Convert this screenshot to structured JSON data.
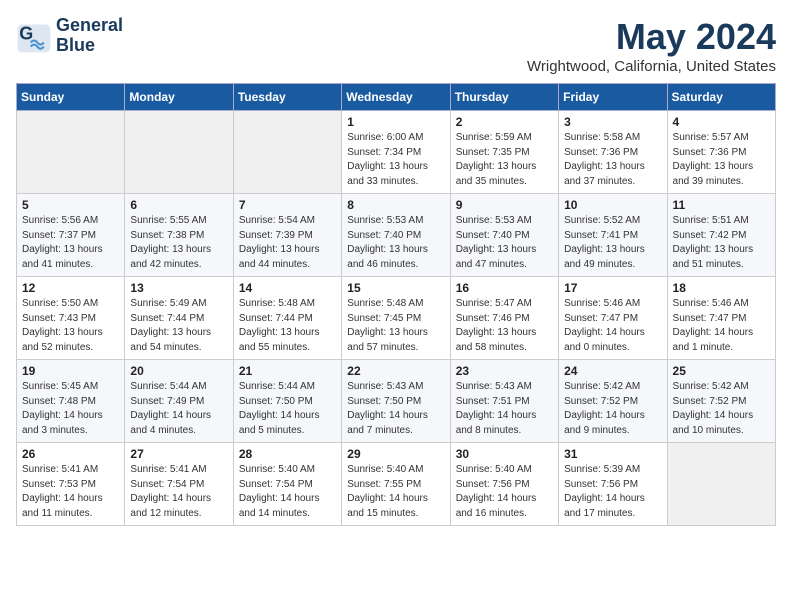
{
  "logo": {
    "line1": "General",
    "line2": "Blue"
  },
  "title": "May 2024",
  "subtitle": "Wrightwood, California, United States",
  "weekdays": [
    "Sunday",
    "Monday",
    "Tuesday",
    "Wednesday",
    "Thursday",
    "Friday",
    "Saturday"
  ],
  "weeks": [
    [
      {
        "day": "",
        "empty": true
      },
      {
        "day": "",
        "empty": true
      },
      {
        "day": "",
        "empty": true
      },
      {
        "day": "1",
        "sunrise": "6:00 AM",
        "sunset": "7:34 PM",
        "daylight": "13 hours and 33 minutes."
      },
      {
        "day": "2",
        "sunrise": "5:59 AM",
        "sunset": "7:35 PM",
        "daylight": "13 hours and 35 minutes."
      },
      {
        "day": "3",
        "sunrise": "5:58 AM",
        "sunset": "7:36 PM",
        "daylight": "13 hours and 37 minutes."
      },
      {
        "day": "4",
        "sunrise": "5:57 AM",
        "sunset": "7:36 PM",
        "daylight": "13 hours and 39 minutes."
      }
    ],
    [
      {
        "day": "5",
        "sunrise": "5:56 AM",
        "sunset": "7:37 PM",
        "daylight": "13 hours and 41 minutes."
      },
      {
        "day": "6",
        "sunrise": "5:55 AM",
        "sunset": "7:38 PM",
        "daylight": "13 hours and 42 minutes."
      },
      {
        "day": "7",
        "sunrise": "5:54 AM",
        "sunset": "7:39 PM",
        "daylight": "13 hours and 44 minutes."
      },
      {
        "day": "8",
        "sunrise": "5:53 AM",
        "sunset": "7:40 PM",
        "daylight": "13 hours and 46 minutes."
      },
      {
        "day": "9",
        "sunrise": "5:53 AM",
        "sunset": "7:40 PM",
        "daylight": "13 hours and 47 minutes."
      },
      {
        "day": "10",
        "sunrise": "5:52 AM",
        "sunset": "7:41 PM",
        "daylight": "13 hours and 49 minutes."
      },
      {
        "day": "11",
        "sunrise": "5:51 AM",
        "sunset": "7:42 PM",
        "daylight": "13 hours and 51 minutes."
      }
    ],
    [
      {
        "day": "12",
        "sunrise": "5:50 AM",
        "sunset": "7:43 PM",
        "daylight": "13 hours and 52 minutes."
      },
      {
        "day": "13",
        "sunrise": "5:49 AM",
        "sunset": "7:44 PM",
        "daylight": "13 hours and 54 minutes."
      },
      {
        "day": "14",
        "sunrise": "5:48 AM",
        "sunset": "7:44 PM",
        "daylight": "13 hours and 55 minutes."
      },
      {
        "day": "15",
        "sunrise": "5:48 AM",
        "sunset": "7:45 PM",
        "daylight": "13 hours and 57 minutes."
      },
      {
        "day": "16",
        "sunrise": "5:47 AM",
        "sunset": "7:46 PM",
        "daylight": "13 hours and 58 minutes."
      },
      {
        "day": "17",
        "sunrise": "5:46 AM",
        "sunset": "7:47 PM",
        "daylight": "14 hours and 0 minutes."
      },
      {
        "day": "18",
        "sunrise": "5:46 AM",
        "sunset": "7:47 PM",
        "daylight": "14 hours and 1 minute."
      }
    ],
    [
      {
        "day": "19",
        "sunrise": "5:45 AM",
        "sunset": "7:48 PM",
        "daylight": "14 hours and 3 minutes."
      },
      {
        "day": "20",
        "sunrise": "5:44 AM",
        "sunset": "7:49 PM",
        "daylight": "14 hours and 4 minutes."
      },
      {
        "day": "21",
        "sunrise": "5:44 AM",
        "sunset": "7:50 PM",
        "daylight": "14 hours and 5 minutes."
      },
      {
        "day": "22",
        "sunrise": "5:43 AM",
        "sunset": "7:50 PM",
        "daylight": "14 hours and 7 minutes."
      },
      {
        "day": "23",
        "sunrise": "5:43 AM",
        "sunset": "7:51 PM",
        "daylight": "14 hours and 8 minutes."
      },
      {
        "day": "24",
        "sunrise": "5:42 AM",
        "sunset": "7:52 PM",
        "daylight": "14 hours and 9 minutes."
      },
      {
        "day": "25",
        "sunrise": "5:42 AM",
        "sunset": "7:52 PM",
        "daylight": "14 hours and 10 minutes."
      }
    ],
    [
      {
        "day": "26",
        "sunrise": "5:41 AM",
        "sunset": "7:53 PM",
        "daylight": "14 hours and 11 minutes."
      },
      {
        "day": "27",
        "sunrise": "5:41 AM",
        "sunset": "7:54 PM",
        "daylight": "14 hours and 12 minutes."
      },
      {
        "day": "28",
        "sunrise": "5:40 AM",
        "sunset": "7:54 PM",
        "daylight": "14 hours and 14 minutes."
      },
      {
        "day": "29",
        "sunrise": "5:40 AM",
        "sunset": "7:55 PM",
        "daylight": "14 hours and 15 minutes."
      },
      {
        "day": "30",
        "sunrise": "5:40 AM",
        "sunset": "7:56 PM",
        "daylight": "14 hours and 16 minutes."
      },
      {
        "day": "31",
        "sunrise": "5:39 AM",
        "sunset": "7:56 PM",
        "daylight": "14 hours and 17 minutes."
      },
      {
        "day": "",
        "empty": true
      }
    ]
  ]
}
